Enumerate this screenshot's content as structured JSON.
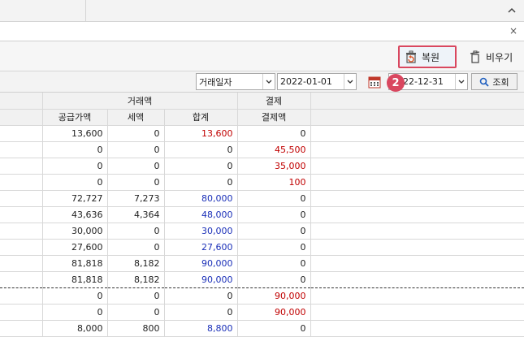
{
  "toolbar": {
    "step_badge": "2",
    "restore_label": "복원",
    "clear_label": "비우기"
  },
  "filter": {
    "date_type": "거래일자",
    "start_date": "2022-01-01",
    "end_date": "2022-12-31",
    "search_label": "조회"
  },
  "table": {
    "group_headers": {
      "trade": "거래액",
      "payment": "결제"
    },
    "columns": {
      "supply": "공급가액",
      "tax": "세액",
      "total": "합계",
      "payment_amount": "결제액"
    },
    "rows": [
      {
        "supply": "13,600",
        "tax": "0",
        "total": "13,600",
        "pay": "0",
        "total_color": "red",
        "pay_color": ""
      },
      {
        "supply": "0",
        "tax": "0",
        "total": "0",
        "pay": "45,500",
        "total_color": "",
        "pay_color": "red"
      },
      {
        "supply": "0",
        "tax": "0",
        "total": "0",
        "pay": "35,000",
        "total_color": "",
        "pay_color": "red"
      },
      {
        "supply": "0",
        "tax": "0",
        "total": "0",
        "pay": "100",
        "total_color": "",
        "pay_color": "red"
      },
      {
        "supply": "72,727",
        "tax": "7,273",
        "total": "80,000",
        "pay": "0",
        "total_color": "blue",
        "pay_color": ""
      },
      {
        "supply": "43,636",
        "tax": "4,364",
        "total": "48,000",
        "pay": "0",
        "total_color": "blue",
        "pay_color": ""
      },
      {
        "supply": "30,000",
        "tax": "0",
        "total": "30,000",
        "pay": "0",
        "total_color": "blue",
        "pay_color": ""
      },
      {
        "supply": "27,600",
        "tax": "0",
        "total": "27,600",
        "pay": "0",
        "total_color": "blue",
        "pay_color": ""
      },
      {
        "supply": "81,818",
        "tax": "8,182",
        "total": "90,000",
        "pay": "0",
        "total_color": "blue",
        "pay_color": ""
      },
      {
        "supply": "81,818",
        "tax": "8,182",
        "total": "90,000",
        "pay": "0",
        "total_color": "blue",
        "pay_color": ""
      },
      {
        "supply": "0",
        "tax": "0",
        "total": "0",
        "pay": "90,000",
        "total_color": "",
        "pay_color": "red"
      },
      {
        "supply": "0",
        "tax": "0",
        "total": "0",
        "pay": "90,000",
        "total_color": "",
        "pay_color": "red"
      },
      {
        "supply": "8,000",
        "tax": "800",
        "total": "8,800",
        "pay": "0",
        "total_color": "blue",
        "pay_color": ""
      }
    ]
  },
  "colors": {
    "red": "#c00000",
    "blue": "#1a2fb8",
    "highlight": "#d9475f"
  },
  "icons": {
    "restore": "restore-icon",
    "clear": "trash-icon",
    "calendar": "calendar-icon",
    "search": "search-icon"
  }
}
